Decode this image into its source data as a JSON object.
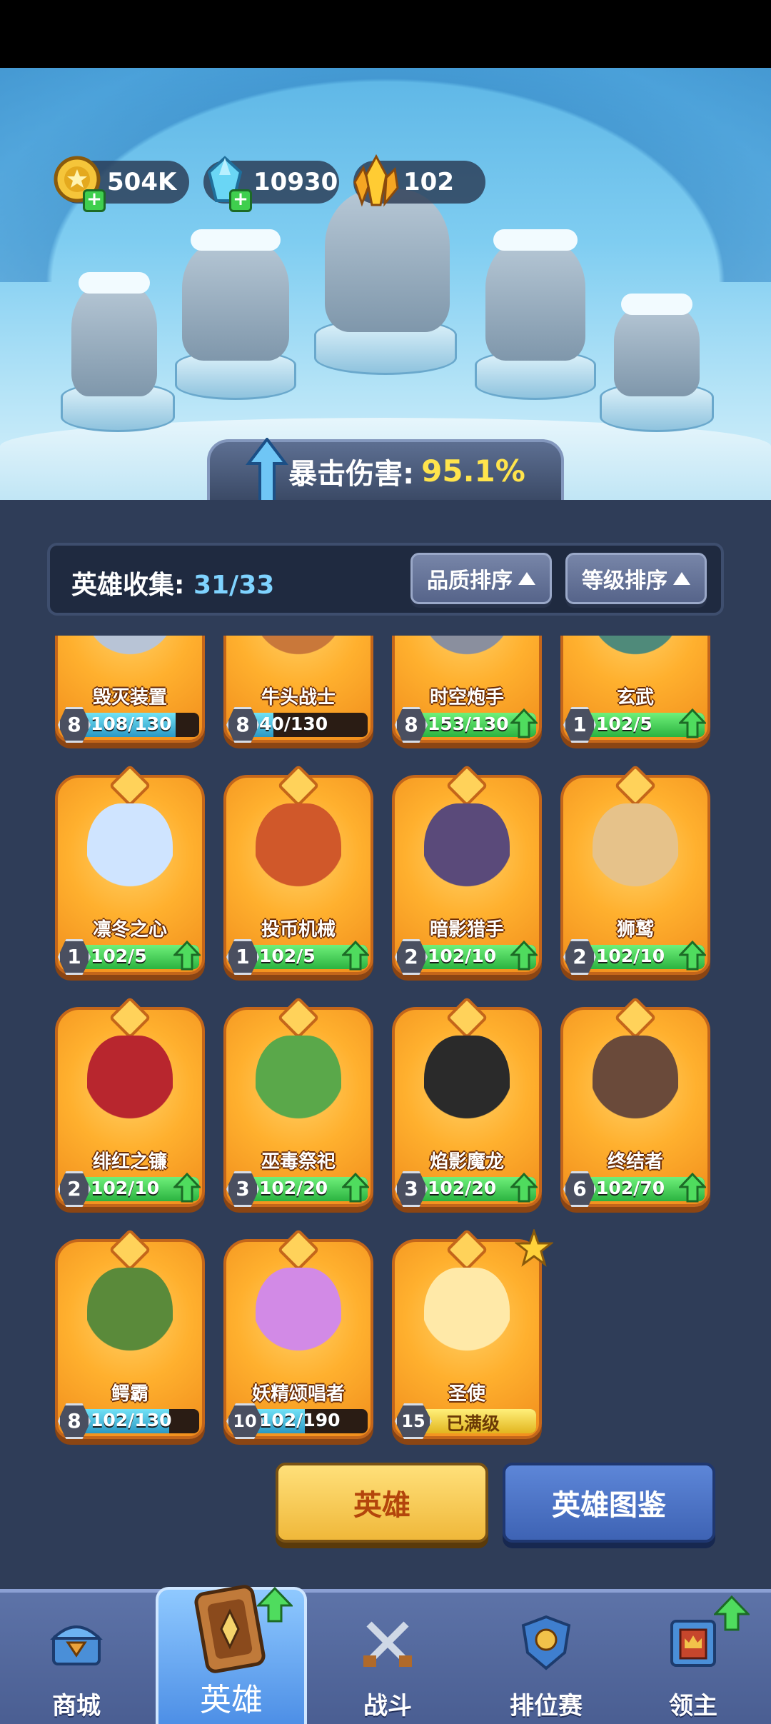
{
  "currencies": {
    "coins": {
      "icon": "coin-icon",
      "value": "504K"
    },
    "gems": {
      "icon": "crystal-icon",
      "value": "10930"
    },
    "shards": {
      "icon": "gold-crystal-icon",
      "value": "102"
    }
  },
  "crit_banner": {
    "label": "暴击伤害:",
    "value": "95.1%"
  },
  "collection": {
    "label": "英雄收集:",
    "count": "31/33"
  },
  "sort": {
    "quality": "品质排序",
    "level": "等级排序"
  },
  "heroes": [
    {
      "name": "毁灭装置",
      "level": "8",
      "progress": "108/130",
      "fill": 0.83,
      "bar": "cyan",
      "upgrade": false
    },
    {
      "name": "牛头战士",
      "level": "8",
      "progress": "40/130",
      "fill": 0.31,
      "bar": "cyan",
      "upgrade": false
    },
    {
      "name": "时空炮手",
      "level": "8",
      "progress": "153/130",
      "fill": 1.0,
      "bar": "green",
      "upgrade": true
    },
    {
      "name": "玄武",
      "level": "1",
      "progress": "102/5",
      "fill": 1.0,
      "bar": "green",
      "upgrade": true
    },
    {
      "name": "凛冬之心",
      "level": "1",
      "progress": "102/5",
      "fill": 1.0,
      "bar": "green",
      "upgrade": true
    },
    {
      "name": "投币机械",
      "level": "1",
      "progress": "102/5",
      "fill": 1.0,
      "bar": "green",
      "upgrade": true
    },
    {
      "name": "暗影猎手",
      "level": "2",
      "progress": "102/10",
      "fill": 1.0,
      "bar": "green",
      "upgrade": true
    },
    {
      "name": "狮鹫",
      "level": "2",
      "progress": "102/10",
      "fill": 1.0,
      "bar": "green",
      "upgrade": true
    },
    {
      "name": "绯红之镰",
      "level": "2",
      "progress": "102/10",
      "fill": 1.0,
      "bar": "green",
      "upgrade": true
    },
    {
      "name": "巫毒祭祀",
      "level": "3",
      "progress": "102/20",
      "fill": 1.0,
      "bar": "green",
      "upgrade": true
    },
    {
      "name": "焰影魔龙",
      "level": "3",
      "progress": "102/20",
      "fill": 1.0,
      "bar": "green",
      "upgrade": true
    },
    {
      "name": "终结者",
      "level": "6",
      "progress": "102/70",
      "fill": 1.0,
      "bar": "green",
      "upgrade": true
    },
    {
      "name": "鳄霸",
      "level": "8",
      "progress": "102/130",
      "fill": 0.78,
      "bar": "cyan",
      "upgrade": false
    },
    {
      "name": "妖精颂唱者",
      "level": "10",
      "progress": "102/190",
      "fill": 0.54,
      "bar": "cyan",
      "upgrade": false
    },
    {
      "name": "圣使",
      "level": "15",
      "progress": "已满级",
      "fill": 1.0,
      "bar": "gold",
      "upgrade": false,
      "star": true
    }
  ],
  "buttons": {
    "hero": "英雄",
    "codex": "英雄图鉴"
  },
  "nav": {
    "shop": "商城",
    "hero": "英雄",
    "battle": "战斗",
    "ranked": "排位赛",
    "lord": "领主"
  }
}
